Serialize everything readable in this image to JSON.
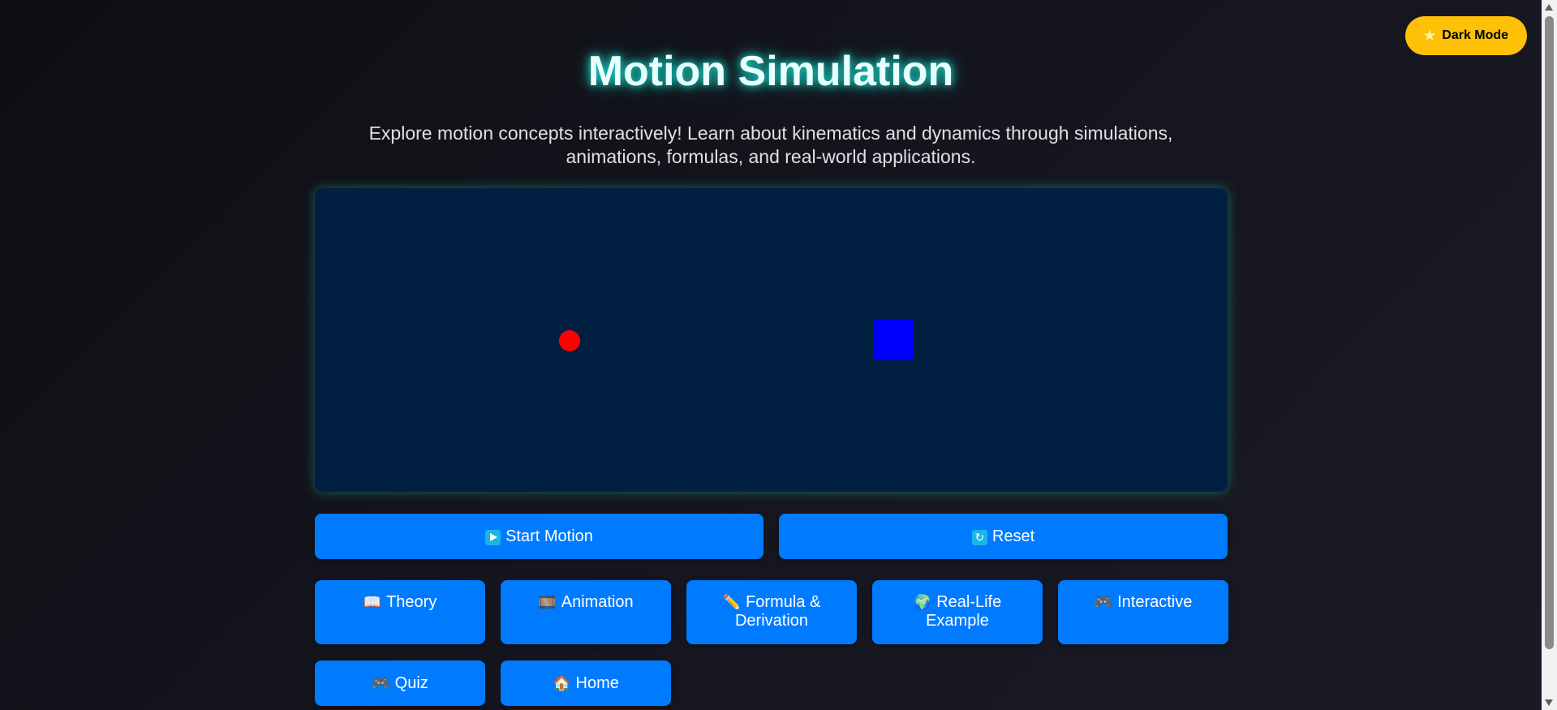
{
  "header": {
    "title": "Motion Simulation",
    "subtitle": "Explore motion concepts interactively! Learn about kinematics and dynamics through simulations, animations, formulas, and real-world applications."
  },
  "mode_toggle": {
    "label": "Dark Mode",
    "icon": "star-icon",
    "color": "#ffc107"
  },
  "simulation": {
    "background": "#012041",
    "ball_color": "#ff0000",
    "box_color": "#0000ff"
  },
  "controls": {
    "start_label": "Start Motion",
    "reset_label": "Reset"
  },
  "nav": {
    "theory": "Theory",
    "animation": "Animation",
    "formula": "Formula & Derivation",
    "real_life": "Real-Life Example",
    "interactive": "Interactive",
    "quiz": "Quiz",
    "home": "Home"
  },
  "colors": {
    "button": "#007bff",
    "title_glow": "#19e6d6"
  }
}
